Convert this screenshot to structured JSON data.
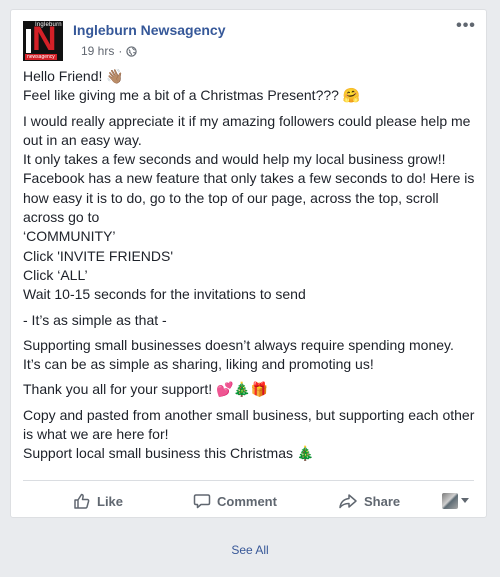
{
  "post": {
    "page_name": "Ingleburn Newsagency",
    "logo_text_top": "Ingleburn",
    "logo_text_bottom": "newsagency",
    "timestamp": "19 hrs",
    "separator": "·",
    "more_icon": "•••",
    "paragraphs": [
      [
        "Hello Friend! 👋🏽",
        "Feel like giving me a bit of a Christmas Present??? 🤗"
      ],
      [
        "I would really appreciate it if my amazing followers could please help me out in an easy way.",
        "It only takes a few seconds and would help my local business grow!!",
        "Facebook has a new feature that only takes a few seconds to do! Here is how easy it is to do, go to the top of our page, across the top, scroll across go to",
        "‘COMMUNITY’",
        "Click 'INVITE FRIENDS'",
        "Click ‘ALL’",
        "Wait 10-15 seconds for the invitations to send"
      ],
      [
        "- It’s as simple as that -"
      ],
      [
        "Supporting small businesses doesn’t always require spending money.",
        "It’s can be as simple as sharing, liking and promoting us!"
      ],
      [
        "Thank you all for your support! 💕🎄🎁"
      ],
      [
        "Copy and pasted from another small business, but supporting each other is what we are here for!",
        "Support local small business this Christmas 🎄"
      ]
    ]
  },
  "actions": {
    "like": "Like",
    "comment": "Comment",
    "share": "Share"
  },
  "footer": {
    "see_all": "See All"
  },
  "colors": {
    "link": "#365899",
    "action": "#606770",
    "background": "#e9ebee"
  }
}
